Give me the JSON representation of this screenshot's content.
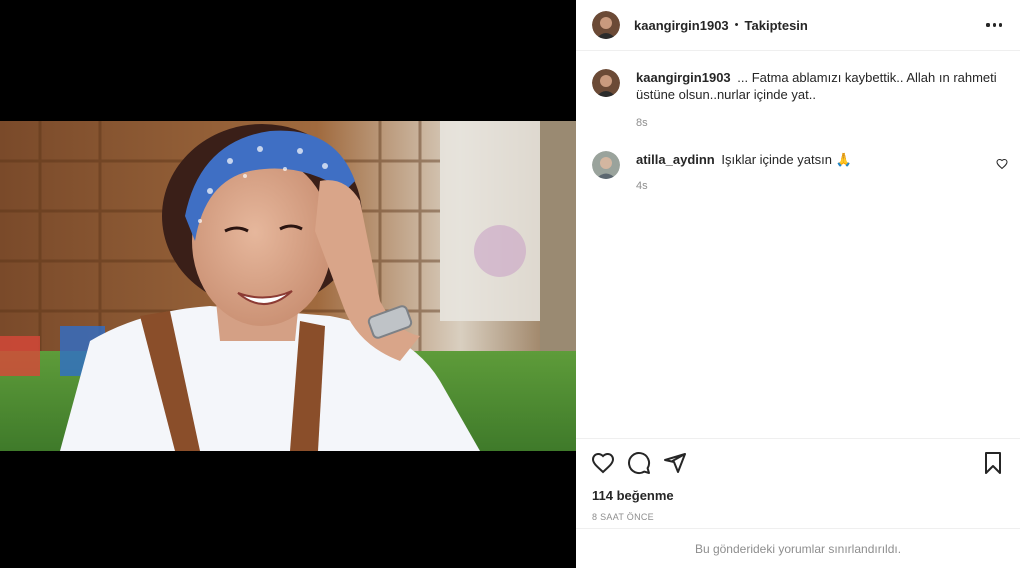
{
  "post": {
    "author": "kaangirgin1903",
    "separator": "•",
    "follow_state": "Takiptesin"
  },
  "caption": {
    "user": "kaangirgin1903",
    "text": "... Fatma ablamızı kaybettik.. Allah ın rahmeti üstüne olsun..nurlar içinde yat..",
    "time": "8s"
  },
  "comments": [
    {
      "user": "atilla_aydinn",
      "text": "Işıklar içinde yatsın 🙏",
      "time": "4s"
    }
  ],
  "actions": {
    "likes": "114 beğenme",
    "posted": "8 SAAT ÖNCE"
  },
  "footer": {
    "restricted_text": "Bu gönderideki yorumlar sınırlandırıldı."
  },
  "icons": [
    "more-options-icon",
    "heart-icon",
    "comment-icon",
    "share-icon",
    "bookmark-icon",
    "like-comment-icon"
  ],
  "colors": {
    "text": "#262626",
    "muted": "#8e8e8e",
    "divider": "#efefef",
    "media_bg": "#000000"
  }
}
